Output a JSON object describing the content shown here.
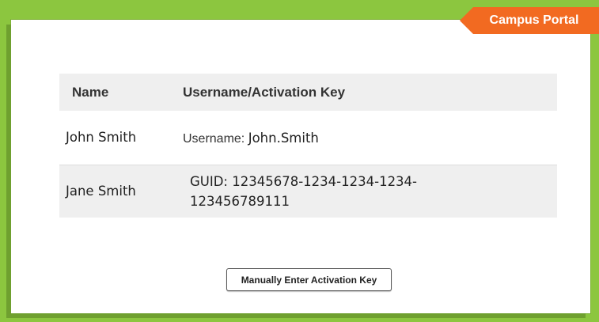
{
  "header": {
    "badge_label": "Campus Portal"
  },
  "table": {
    "columns": [
      "Name",
      "Username/Activation Key"
    ],
    "rows": [
      {
        "name": "John Smith",
        "key_label": "Username: ",
        "key_value": "John.Smith"
      },
      {
        "name": "Jane Smith",
        "key_value": "GUID: 12345678-1234-1234-1234-123456789111"
      }
    ]
  },
  "actions": {
    "manual_entry_label": "Manually Enter Activation Key"
  },
  "colors": {
    "page_background": "#8cc63f",
    "badge_background": "#f26a21",
    "header_row_background": "#efefef"
  }
}
